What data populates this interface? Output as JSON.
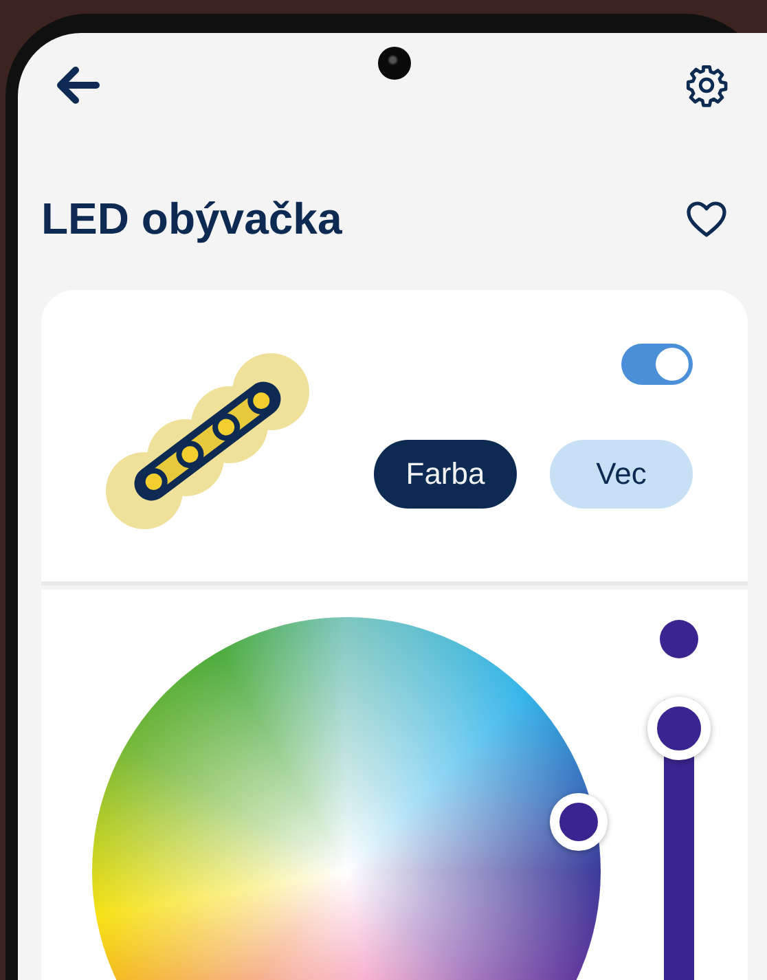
{
  "header": {
    "title": "LED obývačka",
    "favorite": false
  },
  "device": {
    "on": true,
    "modes": [
      {
        "label": "Farba",
        "selected": true
      },
      {
        "label": "Vec",
        "selected": false
      }
    ]
  },
  "brightness": {
    "level": 0.93
  }
}
